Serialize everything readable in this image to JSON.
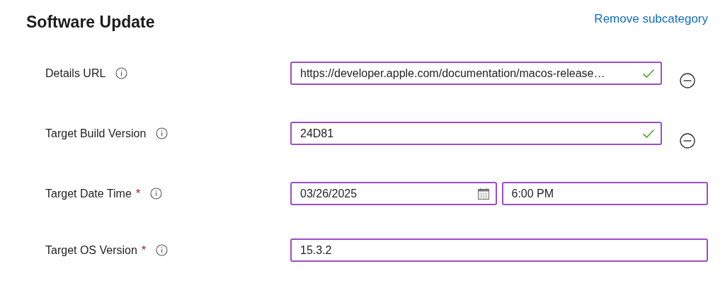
{
  "header": {
    "title": "Software Update",
    "action_link": "Remove subcategory"
  },
  "fields": [
    {
      "kind": "text",
      "label": "Details URL",
      "value": "https://developer.apple.com/documentation/macos-release…",
      "valid": true,
      "removable": true
    },
    {
      "kind": "text",
      "label": "Target Build Version",
      "value": "24D81",
      "valid": true,
      "removable": true
    },
    {
      "kind": "datetime",
      "label": "Target Date Time",
      "required_mark": "*",
      "date": "03/26/2025",
      "time": "6:00 PM"
    },
    {
      "kind": "text",
      "label": "Target OS Version",
      "required_mark": "*",
      "value": "15.3.2",
      "valid": false,
      "removable": false
    }
  ]
}
